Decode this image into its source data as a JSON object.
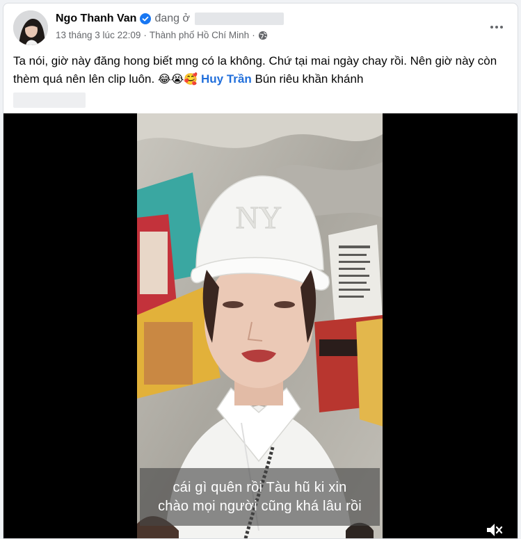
{
  "post": {
    "author": "Ngo Thanh Van",
    "checkin_prefix": "đang ở",
    "date": "13 tháng 3 lúc 22:09",
    "separator": "·",
    "location": "Thành phố Hồ Chí Minh",
    "privacy_icon": "globe-icon",
    "more_icon": "more-options-icon",
    "caption": {
      "text": "Ta nói, giờ này đăng hong biết mng có la không. Chứ tại mai ngày chay rồi. Nên giờ này còn thèm quá nên lên clip luôn.",
      "emojis": "😂😭🥰",
      "mention": "Huy Trần",
      "suffix": "Bún riêu khần khánh"
    }
  },
  "video": {
    "subtitle_line1": "cái gì quên rồi Tàu hũ ki xin",
    "subtitle_line2": "chào mọi người cũng khá lâu rồi",
    "volume_icon": "volume-muted-icon"
  },
  "colors": {
    "link": "#216fdb",
    "verified": "#1877f2",
    "secondary_text": "#65676b"
  }
}
